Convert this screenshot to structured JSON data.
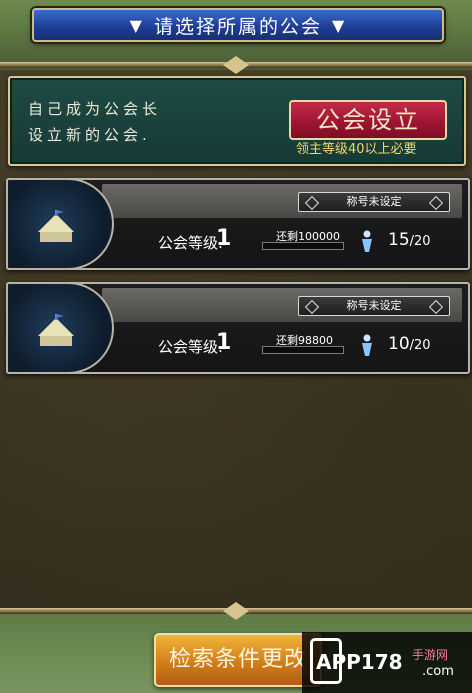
{
  "header": {
    "title": "请选择所属的公会",
    "left_marker": "▼",
    "right_marker": "▼"
  },
  "founder_panel": {
    "line1": "自己成为公会长",
    "line2": "设立新的公会.",
    "found_button": "公会设立",
    "requirement": "领主等级40以上必要"
  },
  "guilds": [
    {
      "title": "称号未设定",
      "level_label": "公会等级.",
      "level": "1",
      "remaining": "还剩100000",
      "members": "15",
      "max_members": "/20"
    },
    {
      "title": "称号未设定",
      "level_label": "公会等级.",
      "level": "1",
      "remaining": "还剩98800",
      "members": "10",
      "max_members": "/20"
    }
  ],
  "search_button": "检索条件更改",
  "watermark": {
    "brand": "APP178",
    "cn": "手游网",
    "com": ".com"
  },
  "colors": {
    "header_blue": "#1e3f95",
    "found_button_red": "#a01533",
    "requirement_yellow": "#f2d86a",
    "search_button_orange": "#d07f1c"
  }
}
